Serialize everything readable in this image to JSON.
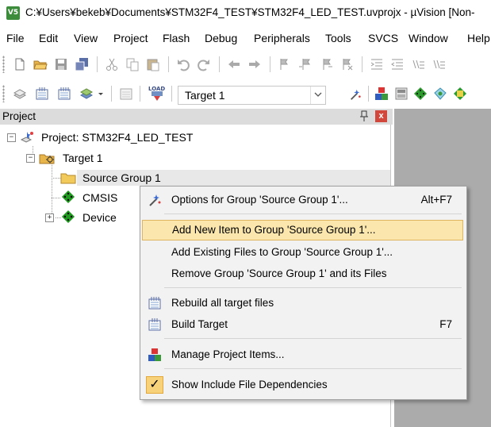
{
  "window": {
    "title": "C:¥Users¥bekeb¥Documents¥STM32F4_TEST¥STM32F4_LED_TEST.uvprojx - µVision  [Non-",
    "app_icon_text": "V5"
  },
  "menubar": [
    "File",
    "Edit",
    "View",
    "Project",
    "Flash",
    "Debug",
    "Peripherals",
    "Tools",
    "SVCS",
    "Window",
    "Help"
  ],
  "toolbar2": {
    "target": "Target 1",
    "load_label": "LOAD"
  },
  "project_panel": {
    "title": "Project",
    "close_label": "x",
    "pin_glyph": "🖈"
  },
  "tree": {
    "project": "Project: STM32F4_LED_TEST",
    "target": "Target 1",
    "source_group": "Source Group 1",
    "cmsis": "CMSIS",
    "device": "Device",
    "collapse_glyph": "−",
    "expand_glyph": "+"
  },
  "context_menu": {
    "items": [
      {
        "label": "Options for Group 'Source Group 1'...",
        "shortcut": "Alt+F7"
      },
      {
        "label": "Add New  Item to Group 'Source Group 1'...",
        "shortcut": ""
      },
      {
        "label": "Add Existing Files to Group 'Source Group 1'...",
        "shortcut": ""
      },
      {
        "label": "Remove Group 'Source Group 1' and its Files",
        "shortcut": ""
      },
      {
        "label": "Rebuild all target files",
        "shortcut": ""
      },
      {
        "label": "Build Target",
        "shortcut": "F7"
      },
      {
        "label": "Manage Project Items...",
        "shortcut": ""
      },
      {
        "label": "Show Include File Dependencies",
        "shortcut": ""
      }
    ],
    "check_glyph": "✓",
    "highlighted_index": 1
  },
  "colors": {
    "menu_highlight": "#fbe7ad",
    "panel_close": "#d2473b",
    "workspace_gray": "#ababab"
  }
}
